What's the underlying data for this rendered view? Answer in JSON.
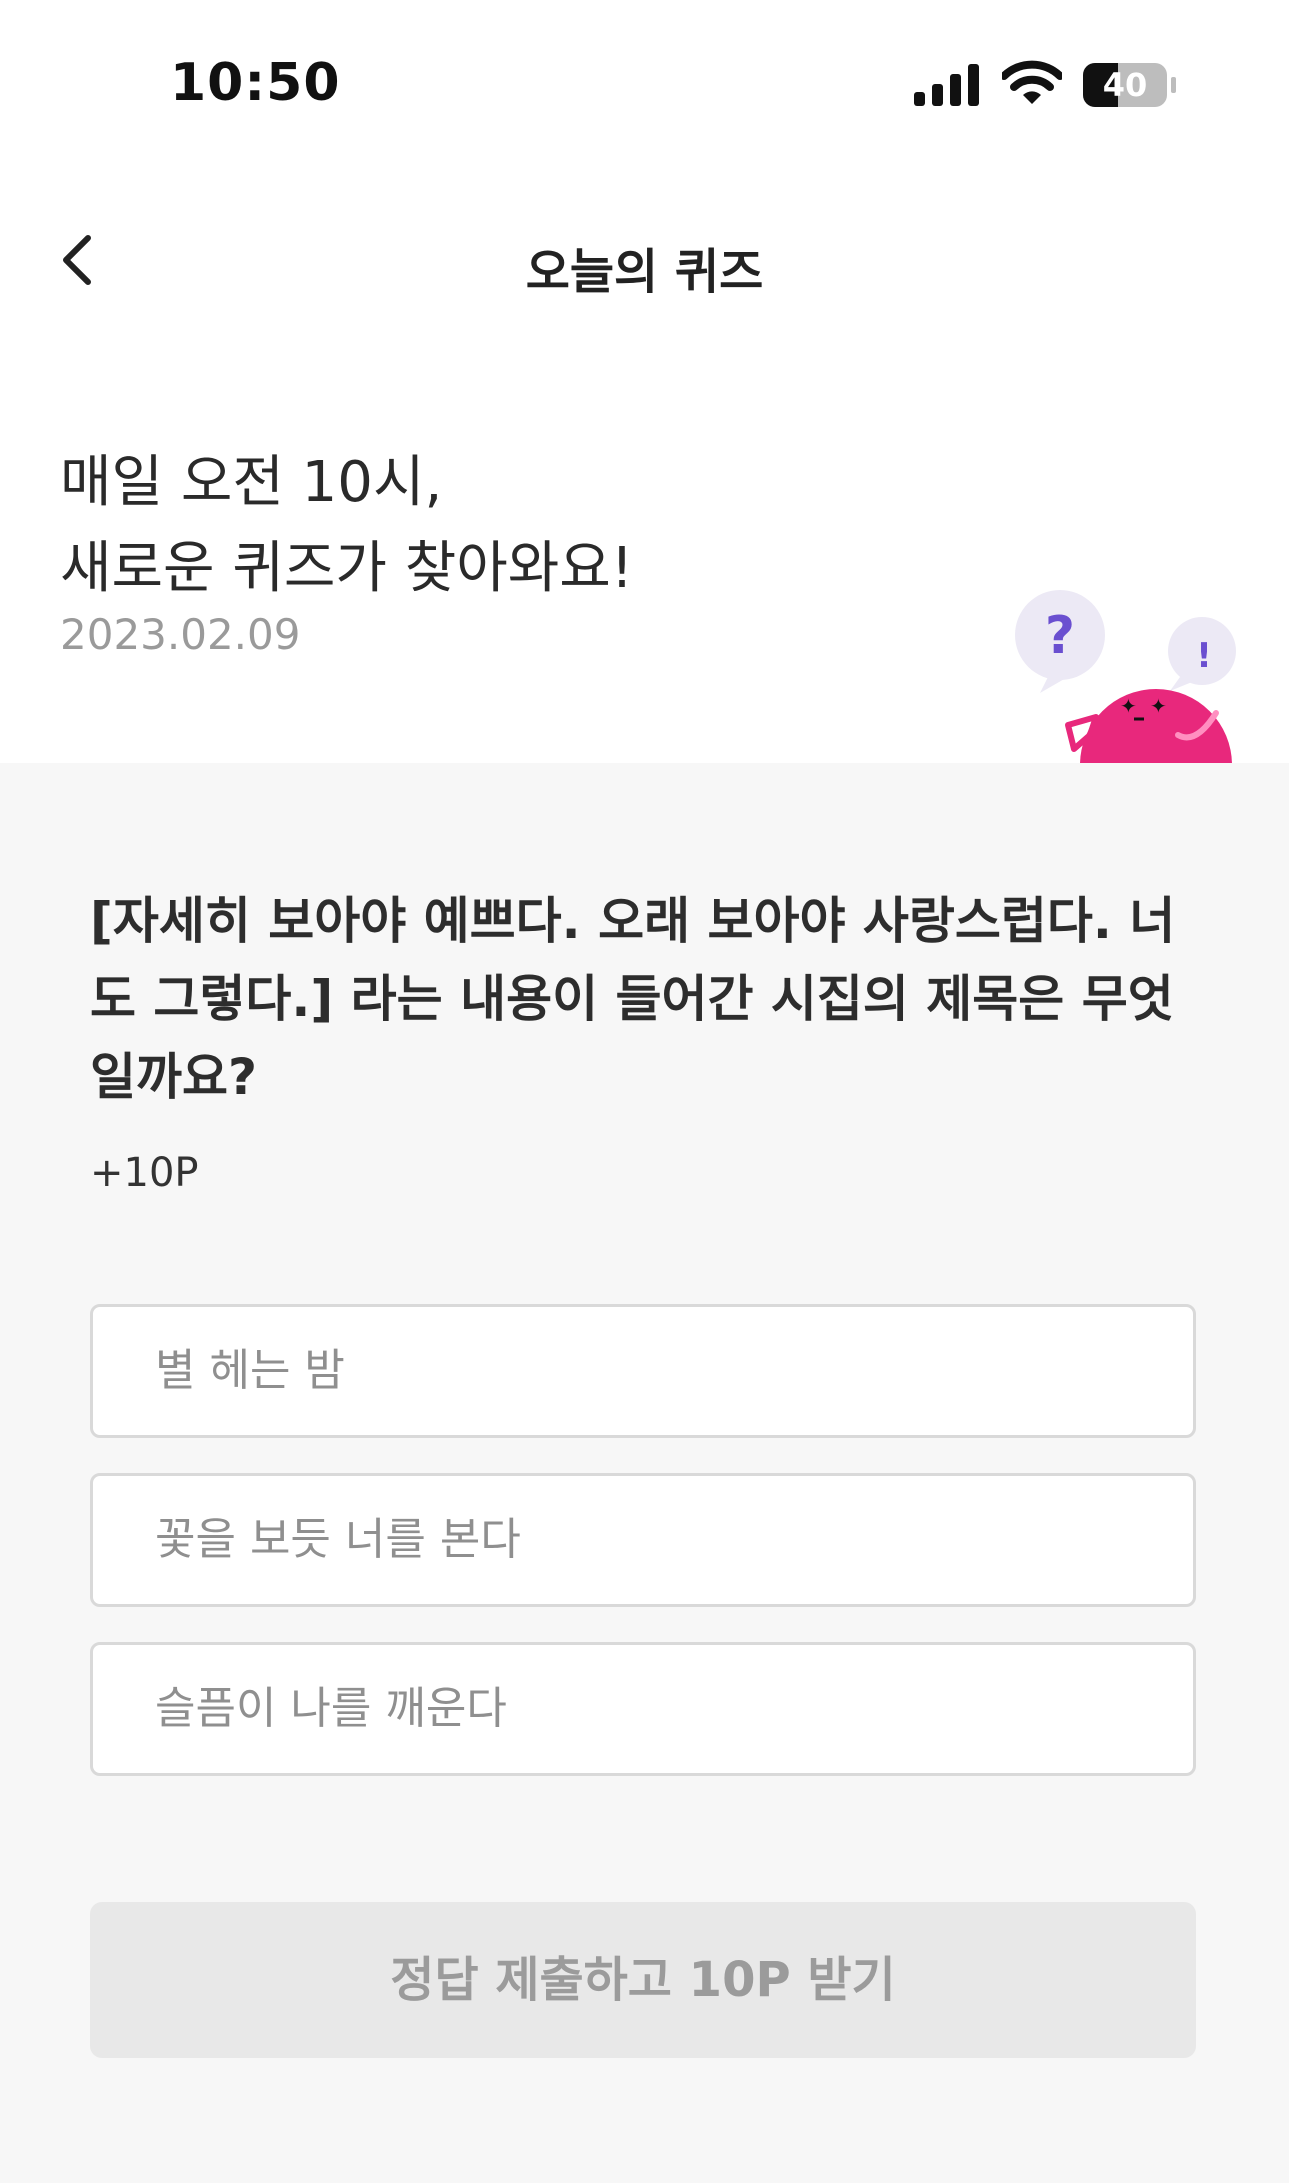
{
  "status_bar": {
    "time": "10:50",
    "battery": "40"
  },
  "nav": {
    "title": "오늘의 퀴즈"
  },
  "hero": {
    "line1": "매일 오전 10시,",
    "line2": "새로운 퀴즈가 찾아와요!",
    "date": "2023.02.09"
  },
  "quiz": {
    "question": "[자세히 보아야 예쁘다. 오래 보아야 사랑스럽다. 너도 그렇다.] 라는 내용이 들어간 시집의 제목은 무엇일까요?",
    "points": "+10P",
    "options": [
      "별 헤는 밤",
      "꽃을 보듯 너를 본다",
      "슬픔이 나를 깨운다"
    ],
    "submit_label": "정답 제출하고 10P 받기"
  },
  "colors": {
    "mascot": "#e8287c",
    "bubble": "#ece9f5",
    "bubble_mark": "#6a4fd0",
    "submit_bg": "#e8e8e8"
  },
  "icons": [
    "signal-icon",
    "wifi-icon",
    "battery-icon",
    "back-chevron-icon",
    "question-bubble-icon",
    "exclamation-bubble-icon",
    "mascot-icon"
  ]
}
